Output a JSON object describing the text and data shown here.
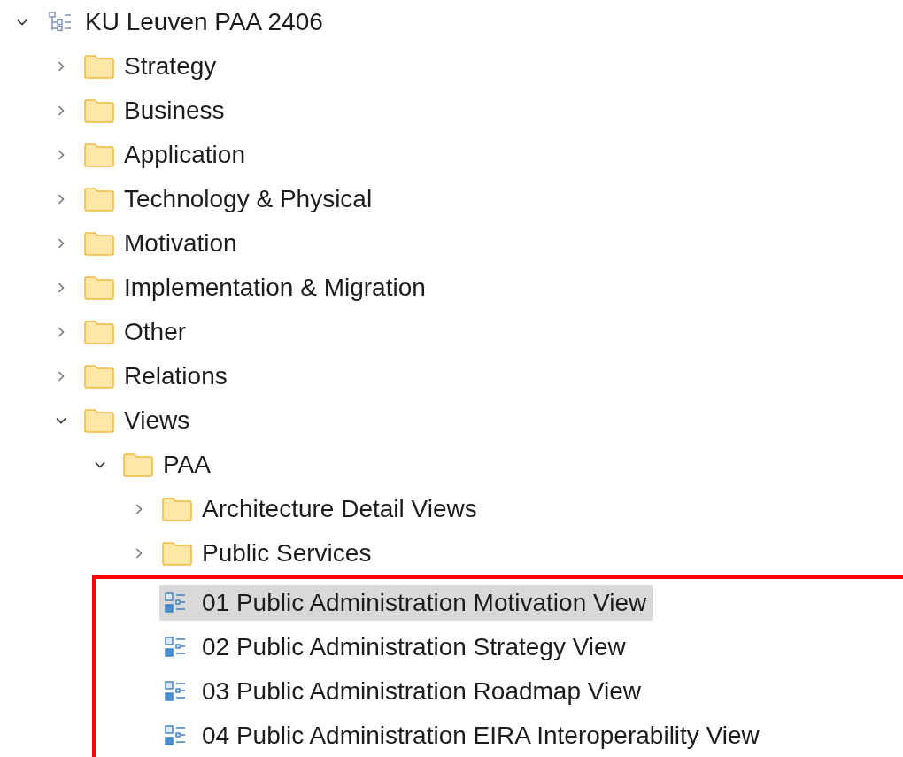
{
  "tree": [
    {
      "kind": "model",
      "label": "KU Leuven PAA 2406",
      "expanded": true,
      "children": [
        {
          "kind": "folder",
          "label": "Strategy",
          "expanded": false
        },
        {
          "kind": "folder",
          "label": "Business",
          "expanded": false
        },
        {
          "kind": "folder",
          "label": "Application",
          "expanded": false
        },
        {
          "kind": "folder",
          "label": "Technology & Physical",
          "expanded": false
        },
        {
          "kind": "folder",
          "label": "Motivation",
          "expanded": false
        },
        {
          "kind": "folder",
          "label": "Implementation & Migration",
          "expanded": false
        },
        {
          "kind": "folder",
          "label": "Other",
          "expanded": false
        },
        {
          "kind": "folder",
          "label": "Relations",
          "expanded": false
        },
        {
          "kind": "folder",
          "label": "Views",
          "expanded": true,
          "children": [
            {
              "kind": "folder",
              "label": "PAA",
              "expanded": true,
              "children": [
                {
                  "kind": "folder",
                  "label": "Architecture Detail Views",
                  "expanded": false
                },
                {
                  "kind": "folder",
                  "label": "Public Services",
                  "expanded": false
                },
                {
                  "kind": "view",
                  "label": "01 Public Administration Motivation View",
                  "selected": true,
                  "highlighted": true
                },
                {
                  "kind": "view",
                  "label": "02 Public Administration Strategy View",
                  "selected": false,
                  "highlighted": true
                },
                {
                  "kind": "view",
                  "label": "03 Public Administration Roadmap View",
                  "selected": false,
                  "highlighted": true
                },
                {
                  "kind": "view",
                  "label": "04 Public Administration EIRA Interoperability View",
                  "selected": false,
                  "highlighted": true
                }
              ]
            }
          ]
        }
      ]
    }
  ]
}
